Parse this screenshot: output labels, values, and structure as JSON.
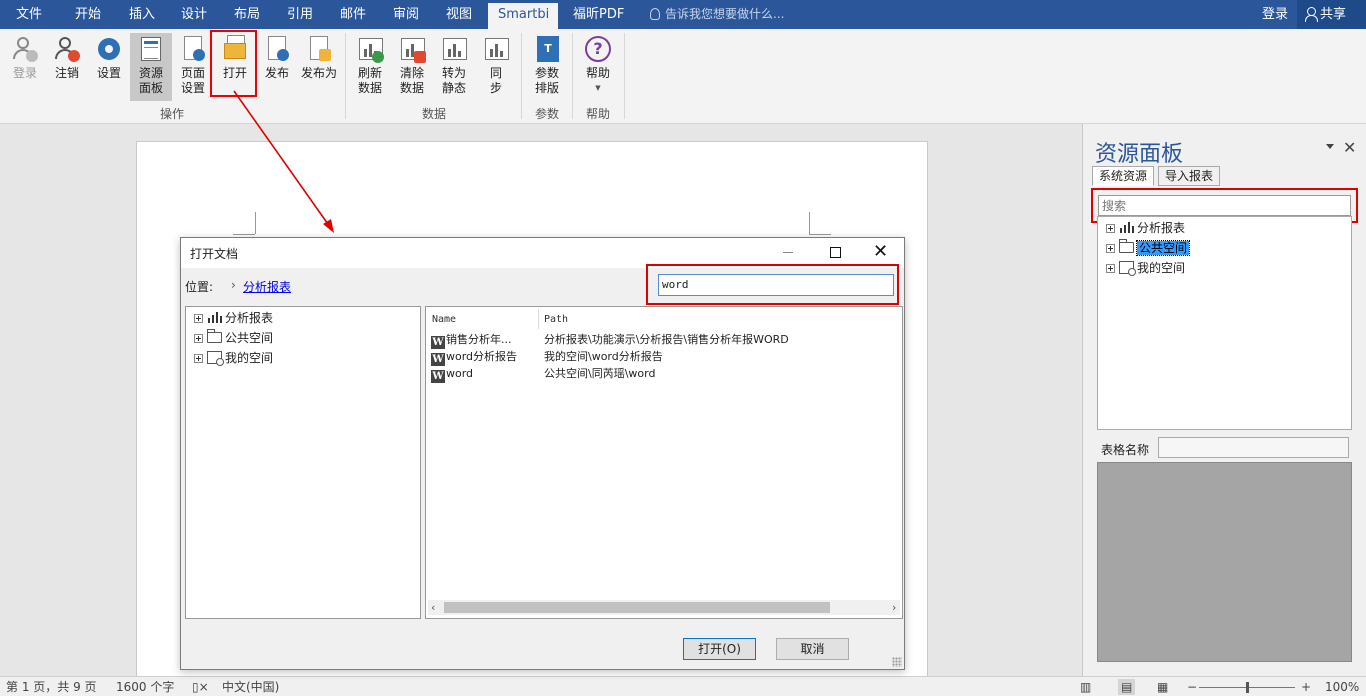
{
  "tabs": [
    "文件",
    "开始",
    "插入",
    "设计",
    "布局",
    "引用",
    "邮件",
    "审阅",
    "视图",
    "Smartbi",
    "福昕PDF"
  ],
  "active_tab": "Smartbi",
  "tell_me": "告诉我您想要做什么...",
  "top_right": {
    "login": "登录",
    "share": "共享"
  },
  "ribbon": {
    "buttons": {
      "login": "登录",
      "logout": "注销",
      "settings": "设置",
      "resource_panel": "资源\n面板",
      "page_setup": "页面\n设置",
      "open": "打开",
      "publish": "发布",
      "publish_as": "发布为",
      "refresh": "刷新\n数据",
      "clear": "清除\n数据",
      "to_static": "转为\n静态",
      "sync": "同\n步",
      "param_layout": "参数\n排版",
      "help": "帮助"
    },
    "groups": {
      "operations": "操作",
      "data": "数据",
      "params": "参数",
      "help": "帮助"
    }
  },
  "resource_panel": {
    "title": "资源面板",
    "tabs": [
      "系统资源",
      "导入报表"
    ],
    "search_placeholder": "搜索",
    "tree": [
      "分析报表",
      "公共空间",
      "我的空间"
    ],
    "selected": "公共空间",
    "table_name_label": "表格名称",
    "table_name_value": ""
  },
  "dialog": {
    "title": "打开文档",
    "location_label": "位置:",
    "breadcrumb": "分析报表",
    "search_value": "word",
    "tree": [
      "分析报表",
      "公共空间",
      "我的空间"
    ],
    "columns": [
      "Name",
      "Path"
    ],
    "rows": [
      {
        "name": "销售分析年...",
        "path": "分析报表\\功能演示\\分析报告\\销售分析年报WORD"
      },
      {
        "name": "word分析报告",
        "path": "我的空间\\word分析报告"
      },
      {
        "name": "word",
        "path": "公共空间\\同芮瑶\\word"
      }
    ],
    "buttons": {
      "open": "打开(O)",
      "cancel": "取消"
    }
  },
  "statusbar": {
    "page": "第 1 页，共 9 页",
    "words": "1600 个字",
    "language": "中文(中国)",
    "zoom": "100%",
    "zoom_minus": "−",
    "zoom_plus": "+"
  },
  "colors": {
    "accent": "#2b579a",
    "annotation": "#e00000"
  }
}
